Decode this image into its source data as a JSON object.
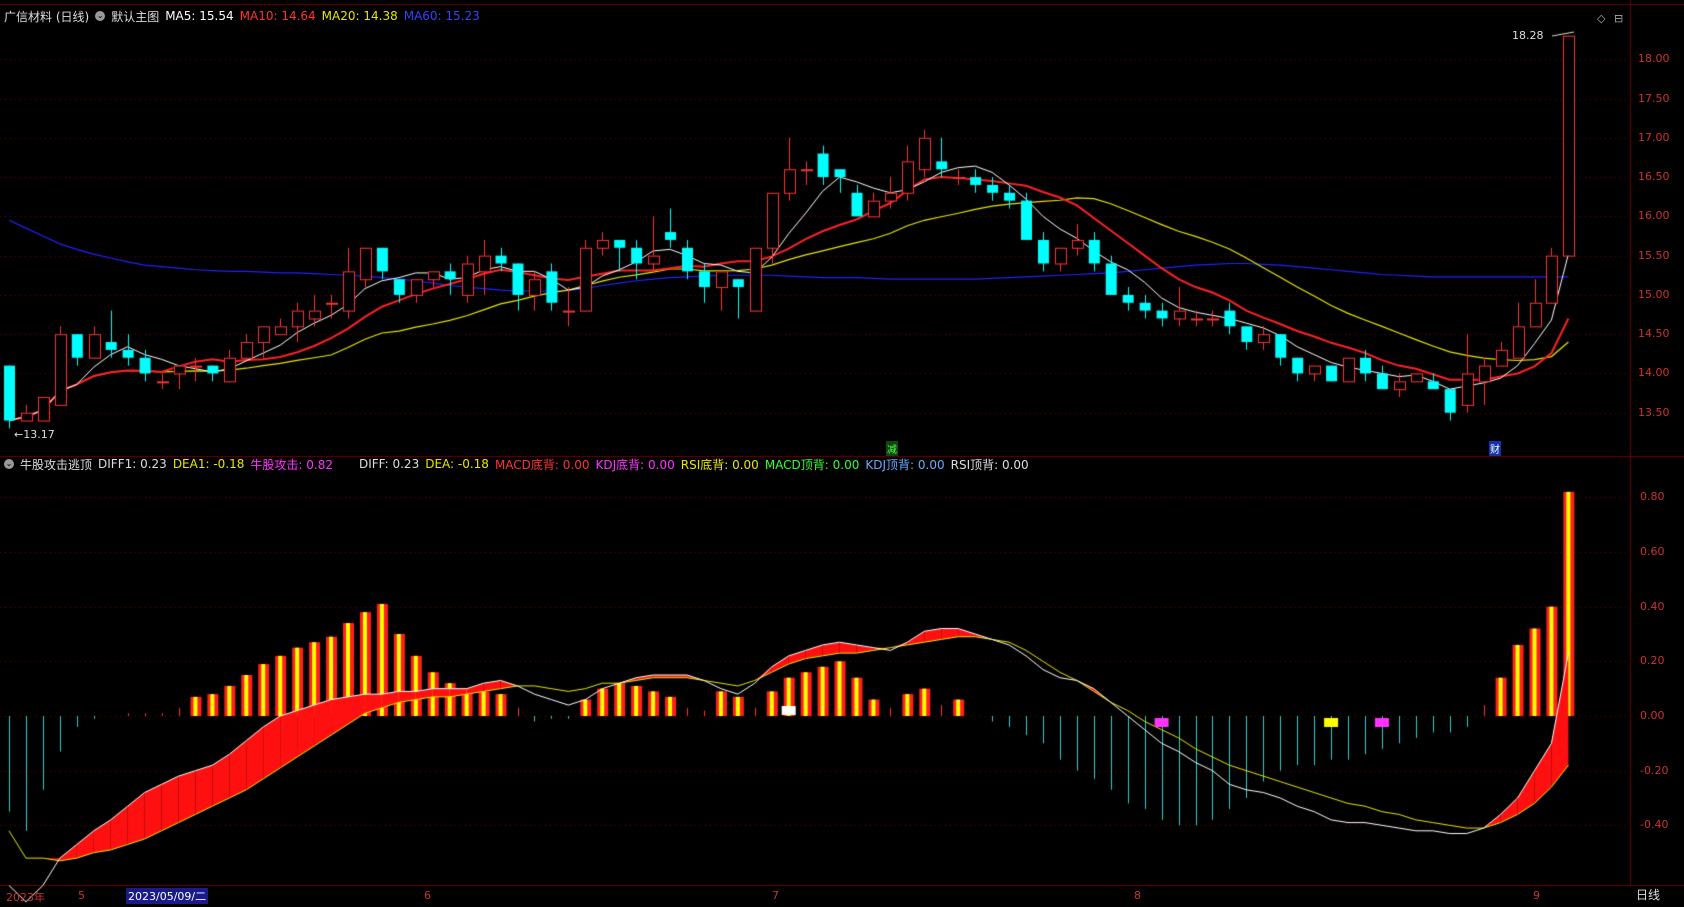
{
  "header": {
    "stock_name": "广信材料 (日线)",
    "main_label": "默认主图",
    "ma5": "MA5: 15.54",
    "ma10": "MA10: 14.64",
    "ma20": "MA20: 14.38",
    "ma60": "MA60: 15.23"
  },
  "indicator_header": {
    "name": "牛股攻击逃顶",
    "diff1": "DIFF1: 0.23",
    "dea1": "DEA1: -0.18",
    "attack": "牛股攻击: 0.82",
    "diff": "DIFF: 0.23",
    "dea": "DEA: -0.18",
    "macd_bottom": "MACD底背: 0.00",
    "kdj_bottom": "KDJ底背: 0.00",
    "rsi_bottom": "RSI底背: 0.00",
    "macd_top": "MACD顶背: 0.00",
    "kdj_top": "KDJ顶背: 0.00",
    "rsi_top": "RSI顶背: 0.00"
  },
  "price_axis": [
    "18.00",
    "17.50",
    "17.00",
    "16.50",
    "16.00",
    "15.50",
    "15.00",
    "14.50",
    "14.00",
    "13.50"
  ],
  "indicator_axis": [
    "0.80",
    "0.60",
    "0.40",
    "0.20",
    "0.00",
    "-0.20",
    "-0.40"
  ],
  "annotations": {
    "high": "18.28",
    "low": "13.17",
    "jian": "减",
    "cai": "财"
  },
  "dates": {
    "year": "2023年",
    "m5": "5",
    "highlight": "2023/05/09/二",
    "m6": "6",
    "m7": "7",
    "m8": "8",
    "m9": "9"
  },
  "period_tab": "日线",
  "colors": {
    "up": "#ff3333",
    "down": "#00ffff",
    "ma5": "#ffffff",
    "ma10": "#ff2222",
    "ma20": "#e6e600",
    "ma60": "#2222ff",
    "grid": "#6a0000"
  },
  "chart_data": {
    "type": "candlestick",
    "ma_labels": [
      "MA5",
      "MA10",
      "MA20",
      "MA60"
    ],
    "candles": [
      [
        14.1,
        13.4,
        14.1,
        13.3
      ],
      [
        13.4,
        13.5,
        13.6,
        13.4
      ],
      [
        13.4,
        13.7,
        13.7,
        13.4
      ],
      [
        13.6,
        14.5,
        14.6,
        13.6
      ],
      [
        14.5,
        14.2,
        14.5,
        14.1
      ],
      [
        14.2,
        14.5,
        14.6,
        14.2
      ],
      [
        14.4,
        14.3,
        14.8,
        14.2
      ],
      [
        14.3,
        14.2,
        14.5,
        14.1
      ],
      [
        14.2,
        14.0,
        14.3,
        13.9
      ],
      [
        13.9,
        13.9,
        14.0,
        13.8
      ],
      [
        14.0,
        14.1,
        14.1,
        13.8
      ],
      [
        14.1,
        14.1,
        14.2,
        13.9
      ],
      [
        14.1,
        14.0,
        14.1,
        13.9
      ],
      [
        13.9,
        14.2,
        14.3,
        13.9
      ],
      [
        14.2,
        14.4,
        14.5,
        14.2
      ],
      [
        14.4,
        14.6,
        14.6,
        14.2
      ],
      [
        14.5,
        14.6,
        14.7,
        14.5
      ],
      [
        14.6,
        14.8,
        14.9,
        14.4
      ],
      [
        14.7,
        14.8,
        15.0,
        14.6
      ],
      [
        14.9,
        14.9,
        15.0,
        14.7
      ],
      [
        14.8,
        15.3,
        15.6,
        14.7
      ],
      [
        15.2,
        15.6,
        15.6,
        15.1
      ],
      [
        15.6,
        15.3,
        15.6,
        15.2
      ],
      [
        15.2,
        15.0,
        15.2,
        14.9
      ],
      [
        15.0,
        15.2,
        15.2,
        14.9
      ],
      [
        15.2,
        15.3,
        15.3,
        15.1
      ],
      [
        15.3,
        15.2,
        15.4,
        15.0
      ],
      [
        15.0,
        15.4,
        15.5,
        14.9
      ],
      [
        15.3,
        15.5,
        15.7,
        15.0
      ],
      [
        15.5,
        15.4,
        15.6,
        15.3
      ],
      [
        15.4,
        15.0,
        15.4,
        14.8
      ],
      [
        15.0,
        15.2,
        15.3,
        14.8
      ],
      [
        15.3,
        14.9,
        15.4,
        14.8
      ],
      [
        14.8,
        14.8,
        15.1,
        14.6
      ],
      [
        14.8,
        15.6,
        15.7,
        14.8
      ],
      [
        15.6,
        15.7,
        15.8,
        15.5
      ],
      [
        15.7,
        15.6,
        15.7,
        15.3
      ],
      [
        15.6,
        15.4,
        15.7,
        15.2
      ],
      [
        15.4,
        15.5,
        16.0,
        15.3
      ],
      [
        15.8,
        15.7,
        16.1,
        15.6
      ],
      [
        15.6,
        15.3,
        15.7,
        15.2
      ],
      [
        15.3,
        15.1,
        15.4,
        14.9
      ],
      [
        15.1,
        15.3,
        15.3,
        14.8
      ],
      [
        15.2,
        15.1,
        15.2,
        14.7
      ],
      [
        14.8,
        15.6,
        15.6,
        14.8
      ],
      [
        15.6,
        16.3,
        16.3,
        15.4
      ],
      [
        16.3,
        16.6,
        17.0,
        16.2
      ],
      [
        16.6,
        16.6,
        16.7,
        16.4
      ],
      [
        16.8,
        16.5,
        16.9,
        16.4
      ],
      [
        16.6,
        16.5,
        16.6,
        16.3
      ],
      [
        16.3,
        16.0,
        16.4,
        16.0
      ],
      [
        16.0,
        16.2,
        16.3,
        16.0
      ],
      [
        16.2,
        16.3,
        16.5,
        16.1
      ],
      [
        16.3,
        16.7,
        16.9,
        16.2
      ],
      [
        16.6,
        17.0,
        17.1,
        16.5
      ],
      [
        16.7,
        16.6,
        17.0,
        16.5
      ],
      [
        16.5,
        16.5,
        16.6,
        16.4
      ],
      [
        16.5,
        16.4,
        16.6,
        16.3
      ],
      [
        16.4,
        16.3,
        16.5,
        16.2
      ],
      [
        16.3,
        16.2,
        16.4,
        16.1
      ],
      [
        16.2,
        15.7,
        16.3,
        15.7
      ],
      [
        15.7,
        15.4,
        15.8,
        15.3
      ],
      [
        15.4,
        15.6,
        15.6,
        15.3
      ],
      [
        15.6,
        15.7,
        15.9,
        15.5
      ],
      [
        15.7,
        15.4,
        15.8,
        15.3
      ],
      [
        15.4,
        15.0,
        15.5,
        15.0
      ],
      [
        15.0,
        14.9,
        15.1,
        14.8
      ],
      [
        14.9,
        14.8,
        15.0,
        14.7
      ],
      [
        14.8,
        14.7,
        14.9,
        14.6
      ],
      [
        14.7,
        14.8,
        15.1,
        14.6
      ],
      [
        14.7,
        14.7,
        14.8,
        14.6
      ],
      [
        14.7,
        14.7,
        14.8,
        14.6
      ],
      [
        14.8,
        14.6,
        14.9,
        14.5
      ],
      [
        14.6,
        14.4,
        14.6,
        14.3
      ],
      [
        14.4,
        14.5,
        14.6,
        14.3
      ],
      [
        14.5,
        14.2,
        14.5,
        14.1
      ],
      [
        14.2,
        14.0,
        14.2,
        13.9
      ],
      [
        14.0,
        14.1,
        14.1,
        13.9
      ],
      [
        14.1,
        13.9,
        14.1,
        13.9
      ],
      [
        13.9,
        14.2,
        14.2,
        13.9
      ],
      [
        14.2,
        14.0,
        14.3,
        13.9
      ],
      [
        14.0,
        13.8,
        14.1,
        13.8
      ],
      [
        13.8,
        13.9,
        14.0,
        13.7
      ],
      [
        13.9,
        14.0,
        14.0,
        13.9
      ],
      [
        13.9,
        13.8,
        14.0,
        13.8
      ],
      [
        13.8,
        13.5,
        13.8,
        13.4
      ],
      [
        13.6,
        14.0,
        14.5,
        13.5
      ],
      [
        13.9,
        14.1,
        14.2,
        13.6
      ],
      [
        14.1,
        14.3,
        14.4,
        14.1
      ],
      [
        14.2,
        14.6,
        14.9,
        14.2
      ],
      [
        14.6,
        14.9,
        15.2,
        14.6
      ],
      [
        14.9,
        15.5,
        15.6,
        14.9
      ],
      [
        15.5,
        18.3,
        18.3,
        15.5
      ]
    ],
    "ma60": [
      15.95,
      15.85,
      15.75,
      15.65,
      15.58,
      15.52,
      15.47,
      15.42,
      15.38,
      15.36,
      15.34,
      15.32,
      15.31,
      15.3,
      15.3,
      15.29,
      15.28,
      15.28,
      15.27,
      15.26,
      15.25,
      15.24,
      15.22,
      15.2,
      15.18,
      15.15,
      15.12,
      15.1,
      15.08,
      15.06,
      15.05,
      15.05,
      15.05,
      15.06,
      15.08,
      15.12,
      15.15,
      15.18,
      15.2,
      15.22,
      15.23,
      15.24,
      15.25,
      15.25,
      15.25,
      15.25,
      15.24,
      15.23,
      15.22,
      15.22,
      15.22,
      15.21,
      15.2,
      15.2,
      15.2,
      15.2,
      15.2,
      15.2,
      15.21,
      15.22,
      15.23,
      15.24,
      15.25,
      15.26,
      15.27,
      15.28,
      15.3,
      15.32,
      15.34,
      15.36,
      15.38,
      15.39,
      15.4,
      15.4,
      15.39,
      15.38,
      15.36,
      15.34,
      15.32,
      15.3,
      15.28,
      15.26,
      15.25,
      15.24,
      15.23,
      15.23,
      15.23,
      15.23,
      15.23,
      15.23,
      15.23,
      15.23,
      15.23
    ],
    "diff": [
      -0.62,
      -0.68,
      -0.62,
      -0.52,
      -0.47,
      -0.42,
      -0.38,
      -0.33,
      -0.28,
      -0.25,
      -0.22,
      -0.2,
      -0.18,
      -0.14,
      -0.09,
      -0.04,
      0.0,
      0.02,
      0.04,
      0.06,
      0.07,
      0.08,
      0.08,
      0.09,
      0.09,
      0.1,
      0.1,
      0.1,
      0.12,
      0.13,
      0.11,
      0.08,
      0.06,
      0.04,
      0.06,
      0.1,
      0.12,
      0.14,
      0.15,
      0.15,
      0.15,
      0.13,
      0.1,
      0.08,
      0.12,
      0.18,
      0.22,
      0.24,
      0.26,
      0.27,
      0.26,
      0.25,
      0.24,
      0.27,
      0.31,
      0.32,
      0.32,
      0.3,
      0.28,
      0.26,
      0.22,
      0.17,
      0.14,
      0.13,
      0.1,
      0.05,
      0.0,
      -0.05,
      -0.1,
      -0.13,
      -0.17,
      -0.2,
      -0.25,
      -0.27,
      -0.28,
      -0.3,
      -0.33,
      -0.35,
      -0.38,
      -0.39,
      -0.39,
      -0.4,
      -0.41,
      -0.42,
      -0.42,
      -0.43,
      -0.43,
      -0.41,
      -0.36,
      -0.3,
      -0.2,
      -0.1,
      0.23
    ],
    "dea": [
      -0.42,
      -0.52,
      -0.52,
      -0.53,
      -0.52,
      -0.5,
      -0.49,
      -0.47,
      -0.45,
      -0.42,
      -0.39,
      -0.36,
      -0.33,
      -0.3,
      -0.27,
      -0.23,
      -0.19,
      -0.15,
      -0.11,
      -0.07,
      -0.03,
      0.01,
      0.03,
      0.05,
      0.06,
      0.07,
      0.07,
      0.08,
      0.09,
      0.1,
      0.11,
      0.11,
      0.1,
      0.09,
      0.1,
      0.12,
      0.12,
      0.13,
      0.14,
      0.14,
      0.14,
      0.13,
      0.12,
      0.11,
      0.13,
      0.16,
      0.19,
      0.21,
      0.22,
      0.23,
      0.23,
      0.24,
      0.25,
      0.26,
      0.27,
      0.28,
      0.29,
      0.29,
      0.28,
      0.27,
      0.24,
      0.2,
      0.16,
      0.13,
      0.09,
      0.05,
      0.02,
      -0.02,
      -0.05,
      -0.08,
      -0.12,
      -0.15,
      -0.18,
      -0.2,
      -0.22,
      -0.24,
      -0.26,
      -0.28,
      -0.3,
      -0.32,
      -0.33,
      -0.35,
      -0.36,
      -0.38,
      -0.39,
      -0.4,
      -0.41,
      -0.41,
      -0.39,
      -0.36,
      -0.32,
      -0.26,
      -0.18
    ],
    "macd": [
      -0.35,
      -0.42,
      -0.27,
      -0.13,
      -0.04,
      -0.01,
      0.0,
      0.01,
      0.01,
      0.01,
      0.03,
      0.07,
      0.08,
      0.11,
      0.15,
      0.19,
      0.22,
      0.25,
      0.27,
      0.29,
      0.34,
      0.38,
      0.41,
      0.3,
      0.22,
      0.16,
      0.12,
      0.1,
      0.09,
      0.08,
      0.03,
      -0.02,
      -0.01,
      -0.01,
      0.06,
      0.1,
      0.12,
      0.11,
      0.09,
      0.07,
      0.03,
      0.02,
      0.09,
      0.07,
      0.03,
      0.09,
      0.14,
      0.16,
      0.18,
      0.2,
      0.14,
      0.06,
      0.03,
      0.08,
      0.1,
      0.04,
      0.06,
      0.0,
      -0.02,
      -0.04,
      -0.07,
      -0.1,
      -0.16,
      -0.2,
      -0.23,
      -0.27,
      -0.32,
      -0.34,
      -0.38,
      -0.4,
      -0.4,
      -0.38,
      -0.34,
      -0.3,
      -0.24,
      -0.2,
      -0.18,
      -0.18,
      -0.16,
      -0.16,
      -0.14,
      -0.12,
      -0.1,
      -0.08,
      -0.06,
      -0.06,
      -0.04,
      0.04,
      0.14,
      0.26,
      0.32,
      0.4,
      0.82
    ]
  }
}
